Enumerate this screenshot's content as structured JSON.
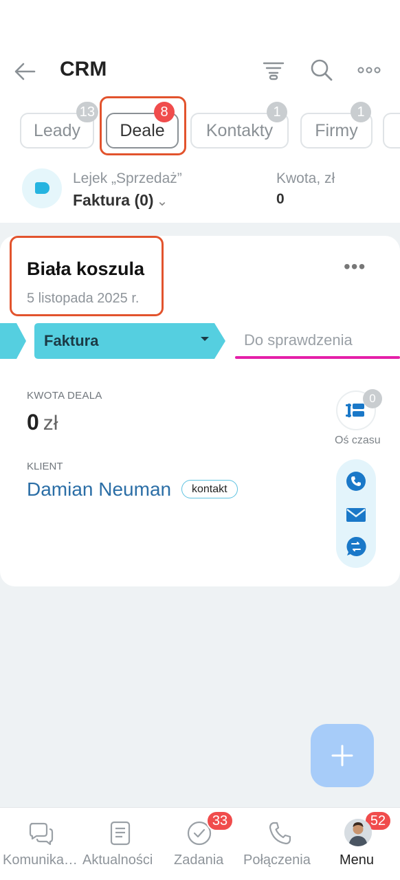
{
  "header": {
    "title": "CRM",
    "icons": [
      "back-arrow-icon",
      "filter-icon",
      "search-icon",
      "more-icon"
    ]
  },
  "tabs": [
    {
      "label": "Leady",
      "badge": "13"
    },
    {
      "label": "Deale",
      "badge": "8"
    },
    {
      "label": "Kontakty",
      "badge": "1"
    },
    {
      "label": "Firmy",
      "badge": "1"
    }
  ],
  "funnel": {
    "label": "Lejek „Sprzedaż”",
    "value": "Faktura (0)",
    "amount_label": "Kwota, zł",
    "amount_value": "0"
  },
  "deal": {
    "title": "Biała koszula",
    "date": "5 listopada 2025 r.",
    "stage_current": "Faktura",
    "stage_next": "Do sprawdzenia",
    "amount_label": "KWOTA DEALA",
    "amount_value": "0",
    "amount_currency": "zł",
    "client_label": "KLIENT",
    "client_name": "Damian Neuman",
    "client_type": "kontakt",
    "timeline_label": "Oś czasu",
    "timeline_count": "0",
    "colors": {
      "stage": "#55cfe0",
      "next_stage_line": "#e51fa8",
      "link": "#2b6ea6"
    }
  },
  "bottom_nav": [
    {
      "label": "Komunika…",
      "icon": "chat-icon"
    },
    {
      "label": "Aktualności",
      "icon": "news-icon"
    },
    {
      "label": "Zadania",
      "icon": "tasks-icon",
      "badge": "33"
    },
    {
      "label": "Połączenia",
      "icon": "phone-icon"
    },
    {
      "label": "Menu",
      "icon": "avatar",
      "badge": "52"
    }
  ]
}
